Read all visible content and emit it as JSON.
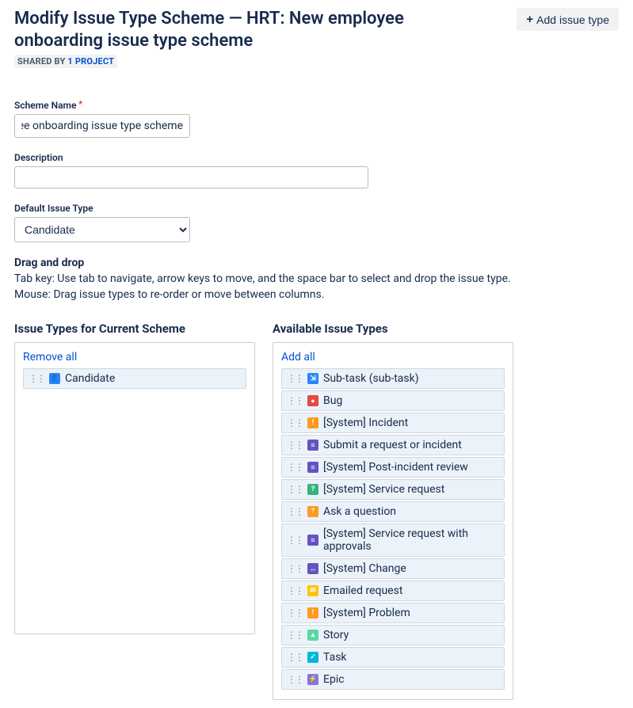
{
  "header": {
    "title": "Modify Issue Type Scheme — HRT: New employee onboarding issue type scheme",
    "addButton": "Add issue type",
    "sharedPrefix": "SHARED BY",
    "sharedLink": "1 PROJECT"
  },
  "form": {
    "schemeName": {
      "label": "Scheme Name",
      "value": "HRT: New employee onboarding issue type scheme"
    },
    "description": {
      "label": "Description",
      "value": ""
    },
    "defaultType": {
      "label": "Default Issue Type",
      "value": "Candidate"
    }
  },
  "dragdrop": {
    "title": "Drag and drop",
    "help1": "Tab key: Use tab to navigate, arrow keys to move, and the space bar to select and drop the issue type.",
    "help2": "Mouse: Drag issue types to re-order or move between columns."
  },
  "currentCol": {
    "title": "Issue Types for Current Scheme",
    "link": "Remove all",
    "items": [
      {
        "label": "Candidate",
        "icon": "candidate-icon",
        "iconClass": "ic-blue",
        "glyph": "👤"
      }
    ]
  },
  "availableCol": {
    "title": "Available Issue Types",
    "link": "Add all",
    "items": [
      {
        "label": "Sub-task (sub-task)",
        "icon": "subtask-icon",
        "iconClass": "ic-blue",
        "glyph": "⇲"
      },
      {
        "label": "Bug",
        "icon": "bug-icon",
        "iconClass": "ic-red",
        "glyph": "●"
      },
      {
        "label": "[System] Incident",
        "icon": "incident-icon",
        "iconClass": "ic-orange",
        "glyph": "!"
      },
      {
        "label": "Submit a request or incident",
        "icon": "request-icon",
        "iconClass": "ic-purple",
        "glyph": "≡"
      },
      {
        "label": "[System] Post-incident review",
        "icon": "review-icon",
        "iconClass": "ic-purple",
        "glyph": "≡"
      },
      {
        "label": "[System] Service request",
        "icon": "service-request-icon",
        "iconClass": "ic-green",
        "glyph": "?"
      },
      {
        "label": "Ask a question",
        "icon": "question-icon",
        "iconClass": "ic-orange",
        "glyph": "?"
      },
      {
        "label": "[System] Service request with approvals",
        "icon": "approvals-icon",
        "iconClass": "ic-purple",
        "glyph": "≡"
      },
      {
        "label": "[System] Change",
        "icon": "change-icon",
        "iconClass": "ic-purple",
        "glyph": "↔"
      },
      {
        "label": "Emailed request",
        "icon": "email-icon",
        "iconClass": "ic-yellow",
        "glyph": "✉"
      },
      {
        "label": "[System] Problem",
        "icon": "problem-icon",
        "iconClass": "ic-orange",
        "glyph": "!"
      },
      {
        "label": "Story",
        "icon": "story-icon",
        "iconClass": "ic-lgreen",
        "glyph": "▴"
      },
      {
        "label": "Task",
        "icon": "task-icon",
        "iconClass": "ic-teal",
        "glyph": "✓"
      },
      {
        "label": "Epic",
        "icon": "epic-icon",
        "iconClass": "ic-dpurp",
        "glyph": "⚡"
      }
    ]
  }
}
